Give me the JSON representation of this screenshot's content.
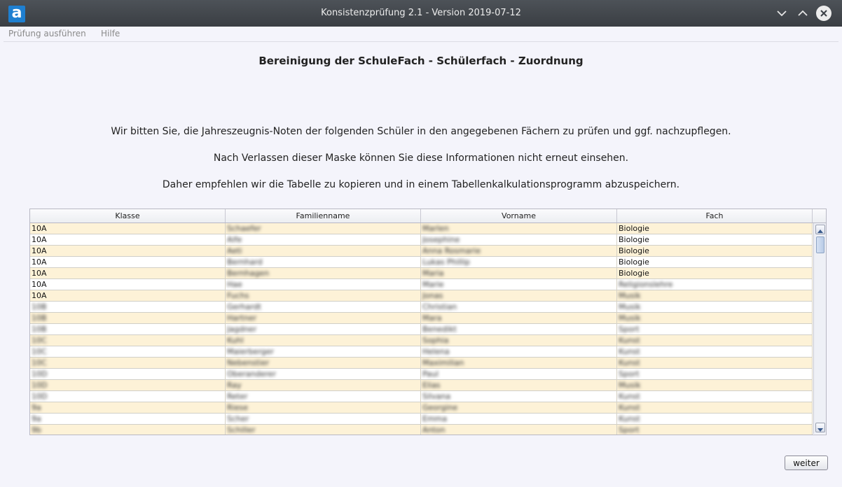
{
  "window": {
    "app_icon": "a",
    "title": "Konsistenzprüfung 2.1 - Version 2019-07-12"
  },
  "menu": {
    "items": [
      "Prüfung ausführen",
      "Hilfe"
    ]
  },
  "main": {
    "heading": "Bereinigung der SchuleFach - Schülerfach - Zuordnung",
    "info_lines": [
      "Wir bitten Sie, die Jahreszeugnis-Noten der folgenden Schüler in den angegebenen Fächern zu prüfen und ggf. nachzupflegen.",
      "Nach Verlassen dieser Maske können Sie diese Informationen nicht erneut einsehen.",
      "Daher empfehlen wir die Tabelle zu kopieren und in einem Tabellenkalkulationsprogramm abzuspeichern."
    ]
  },
  "table": {
    "columns": [
      "Klasse",
      "Familienname",
      "Vorname",
      "Fach"
    ],
    "rows": [
      [
        "10A",
        "Schaefer",
        "Marlen",
        "Biologie"
      ],
      [
        "10A",
        "Aife",
        "Josephine",
        "Biologie"
      ],
      [
        "10A",
        "Aeti",
        "Anna Rosmarie",
        "Biologie"
      ],
      [
        "10A",
        "Bernhard",
        "Lukas Phillip",
        "Biologie"
      ],
      [
        "10A",
        "Bernhagen",
        "Maria",
        "Biologie"
      ],
      [
        "10A",
        "Hae",
        "Marie",
        "Religionslehre"
      ],
      [
        "10A",
        "Fuchs",
        "Jonas",
        "Musik"
      ],
      [
        "10B",
        "Gerhardt",
        "Christian",
        "Musik"
      ],
      [
        "10B",
        "Hartner",
        "Mara",
        "Musik"
      ],
      [
        "10B",
        "Jagdner",
        "Benedikt",
        "Sport"
      ],
      [
        "10C",
        "Kuhl",
        "Sophia",
        "Kunst"
      ],
      [
        "10C",
        "Maierberger",
        "Helena",
        "Kunst"
      ],
      [
        "10C",
        "Nebenstier",
        "Maximilian",
        "Kunst"
      ],
      [
        "10D",
        "Oberanderer",
        "Paul",
        "Sport"
      ],
      [
        "10D",
        "Ray",
        "Elias",
        "Musik"
      ],
      [
        "10D",
        "Reter",
        "Silvana",
        "Kunst"
      ],
      [
        "9a",
        "Riese",
        "Georgine",
        "Kunst"
      ],
      [
        "9a",
        "Scher",
        "Emma",
        "Kunst"
      ],
      [
        "9b",
        "Schiller",
        "Anton",
        "Sport"
      ]
    ],
    "visible_clear_rows": 7
  },
  "buttons": {
    "next_label": "weiter"
  }
}
